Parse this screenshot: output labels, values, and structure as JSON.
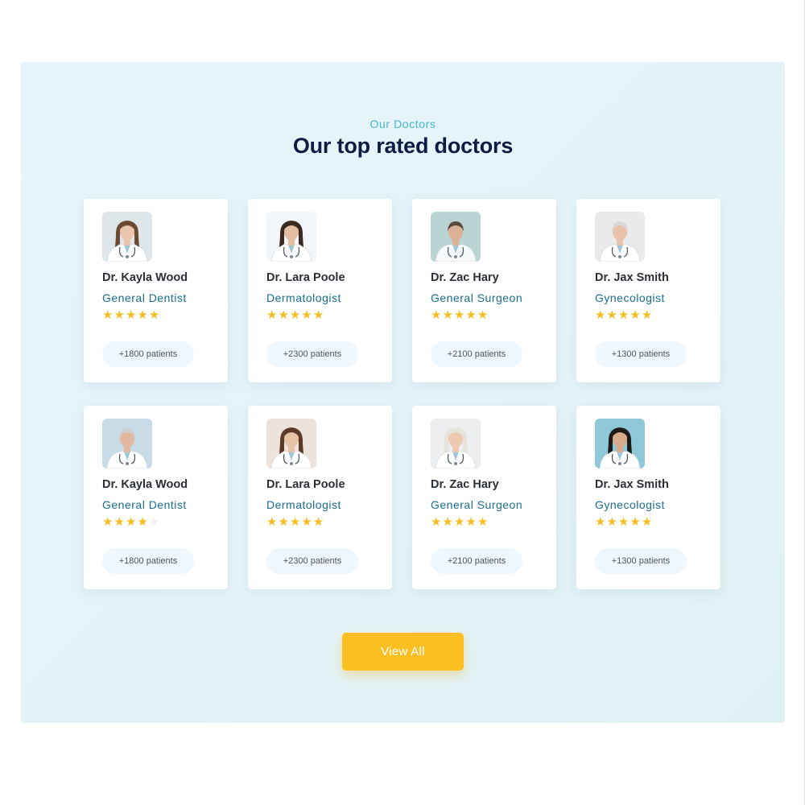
{
  "section": {
    "eyebrow": "Our Doctors",
    "title": "Our top rated doctors"
  },
  "doctors": [
    {
      "name": "Dr. Kayla Wood",
      "specialty": "General Dentist",
      "rating": 5,
      "patients": "+1800 patients",
      "photo": {
        "bg": "#dfe6ea",
        "hair": "#6b4a34",
        "skin": "#e9c6ad",
        "coat": "#ffffff",
        "icon": "female-doctor-photo-icon"
      }
    },
    {
      "name": "Dr. Lara Poole",
      "specialty": "Dermatologist",
      "rating": 5,
      "patients": "+2300 patients",
      "photo": {
        "bg": "#f3f6f8",
        "hair": "#3a2a22",
        "skin": "#e5bfa2",
        "coat": "#ffffff",
        "icon": "female-doctor-photo-icon"
      }
    },
    {
      "name": "Dr. Zac Hary",
      "specialty": "General Surgeon",
      "rating": 5,
      "patients": "+2100 patients",
      "photo": {
        "bg": "#b9d4d2",
        "hair": "#5a4a3c",
        "skin": "#dcb196",
        "coat": "#f6f8f9",
        "icon": "male-doctor-photo-icon"
      }
    },
    {
      "name": "Dr. Jax Smith",
      "specialty": "Gynecologist",
      "rating": 5,
      "patients": "+1300 patients",
      "photo": {
        "bg": "#e8eaec",
        "hair": "#d9d9d9",
        "skin": "#e6c3aa",
        "coat": "#ffffff",
        "icon": "male-doctor-photo-icon"
      }
    },
    {
      "name": "Dr. Kayla Wood",
      "specialty": "General Dentist",
      "rating": 4,
      "patients": "+1800 patients",
      "photo": {
        "bg": "#c9dbe6",
        "hair": "#cfcfcf",
        "skin": "#e2b99e",
        "coat": "#ffffff",
        "icon": "male-doctor-photo-icon"
      }
    },
    {
      "name": "Dr. Lara Poole",
      "specialty": "Dermatologist",
      "rating": 5,
      "patients": "+2300 patients",
      "photo": {
        "bg": "#ece4dc",
        "hair": "#5b3a2a",
        "skin": "#e8c2a6",
        "coat": "#ffffff",
        "icon": "female-doctor-photo-icon"
      }
    },
    {
      "name": "Dr. Zac Hary",
      "specialty": "General Surgeon",
      "rating": 5,
      "patients": "+2100 patients",
      "photo": {
        "bg": "#eceeef",
        "hair": "#e6e3dc",
        "skin": "#ecc9b0",
        "coat": "#ffffff",
        "icon": "female-doctor-photo-icon"
      }
    },
    {
      "name": "Dr. Jax Smith",
      "specialty": "Gynecologist",
      "rating": 5,
      "patients": "+1300 patients",
      "photo": {
        "bg": "#8fc8d8",
        "hair": "#1e1a18",
        "skin": "#d8ab8c",
        "coat": "#ffffff",
        "icon": "female-doctor-photo-icon"
      }
    }
  ],
  "max_rating": 5,
  "cta": {
    "label": "View All"
  },
  "colors": {
    "accent": "#45b6d0",
    "heading": "#0d1c45",
    "specialty": "#1a6e8f",
    "star": "#f7be22",
    "button": "#fbbf22"
  }
}
